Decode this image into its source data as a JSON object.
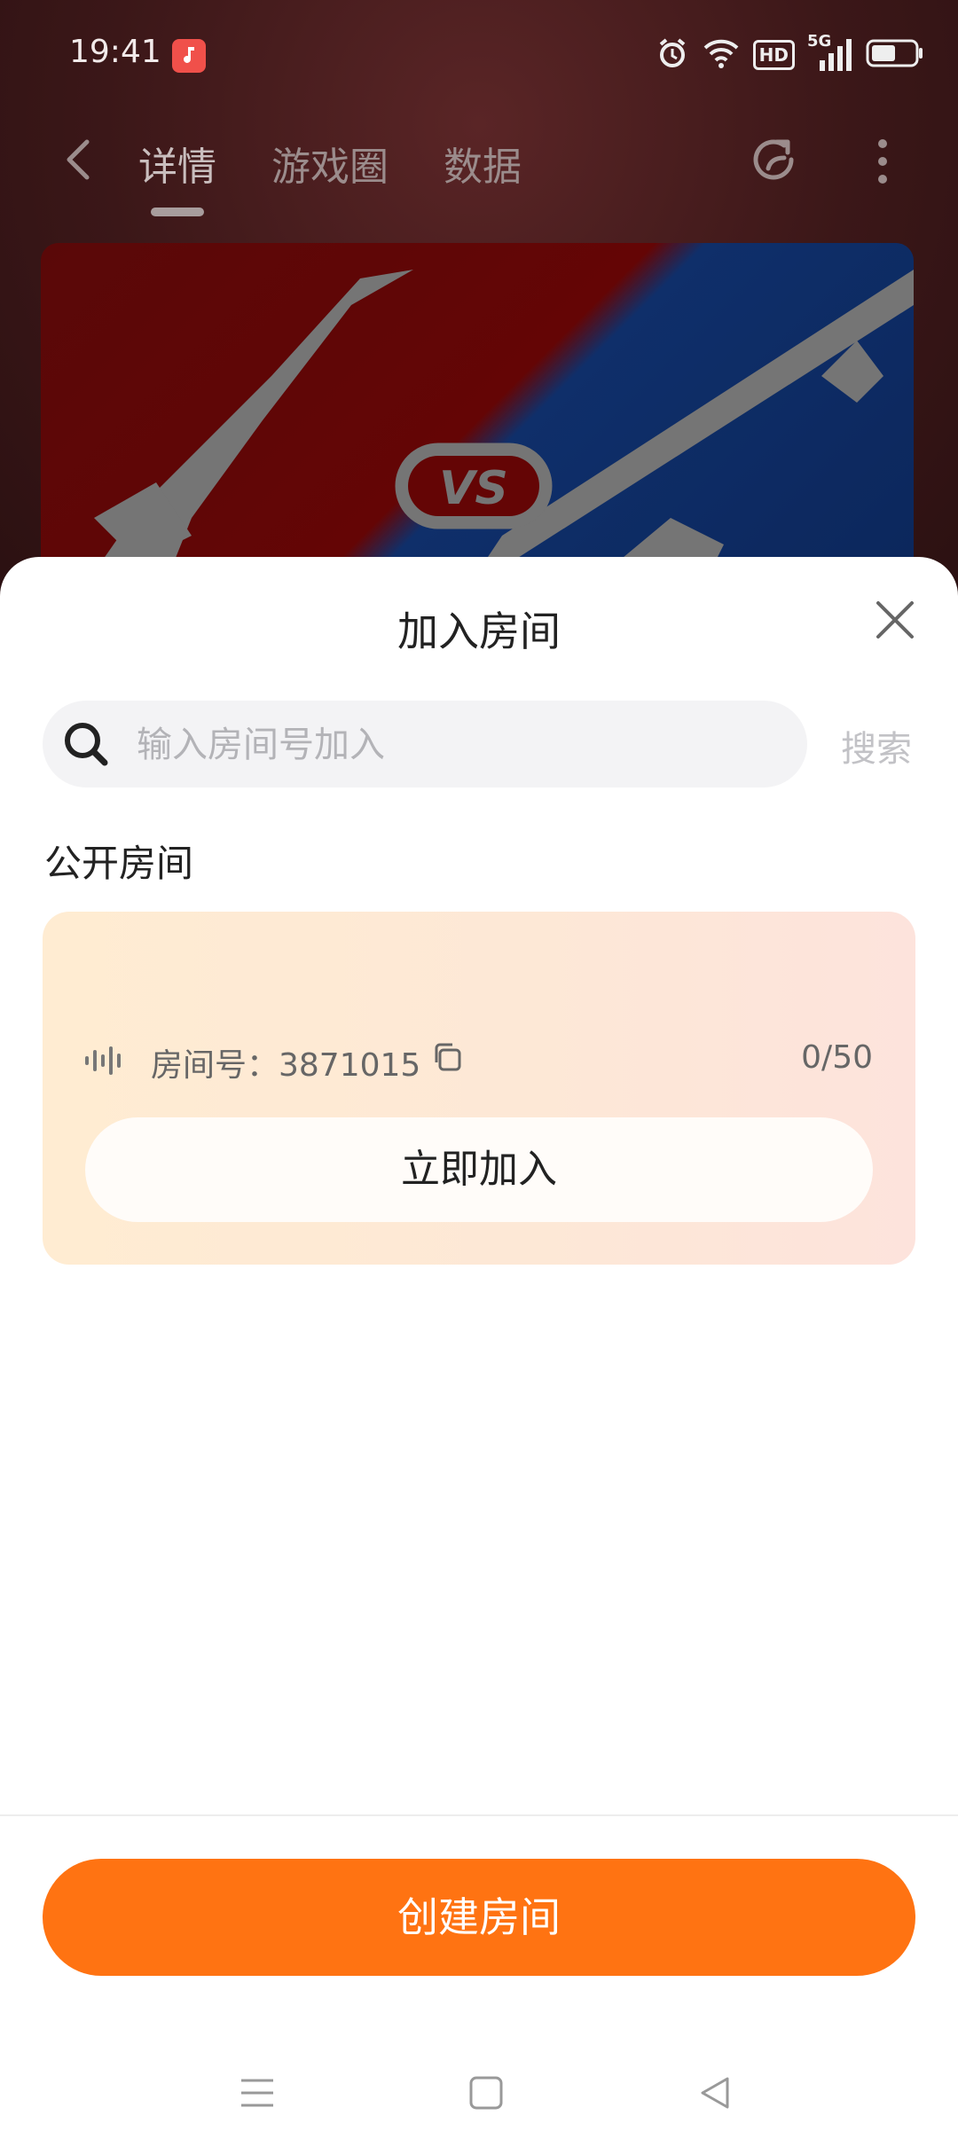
{
  "status_bar": {
    "time": "19:41",
    "network": "5G",
    "hd_badge": "HD"
  },
  "nav": {
    "tabs": [
      {
        "label": "详情",
        "active": true
      },
      {
        "label": "游戏圈",
        "active": false
      },
      {
        "label": "数据",
        "active": false
      }
    ]
  },
  "banner": {
    "vs_text": "VS"
  },
  "sheet": {
    "title": "加入房间",
    "search": {
      "placeholder": "输入房间号加入",
      "button_label": "搜索"
    },
    "section_title": "公开房间",
    "room": {
      "label": "房间号：3871015",
      "count": "0/50",
      "join_label": "立即加入"
    },
    "create_label": "创建房间"
  },
  "colors": {
    "accent": "#ff7312",
    "card_bg": "#ffecd2"
  }
}
